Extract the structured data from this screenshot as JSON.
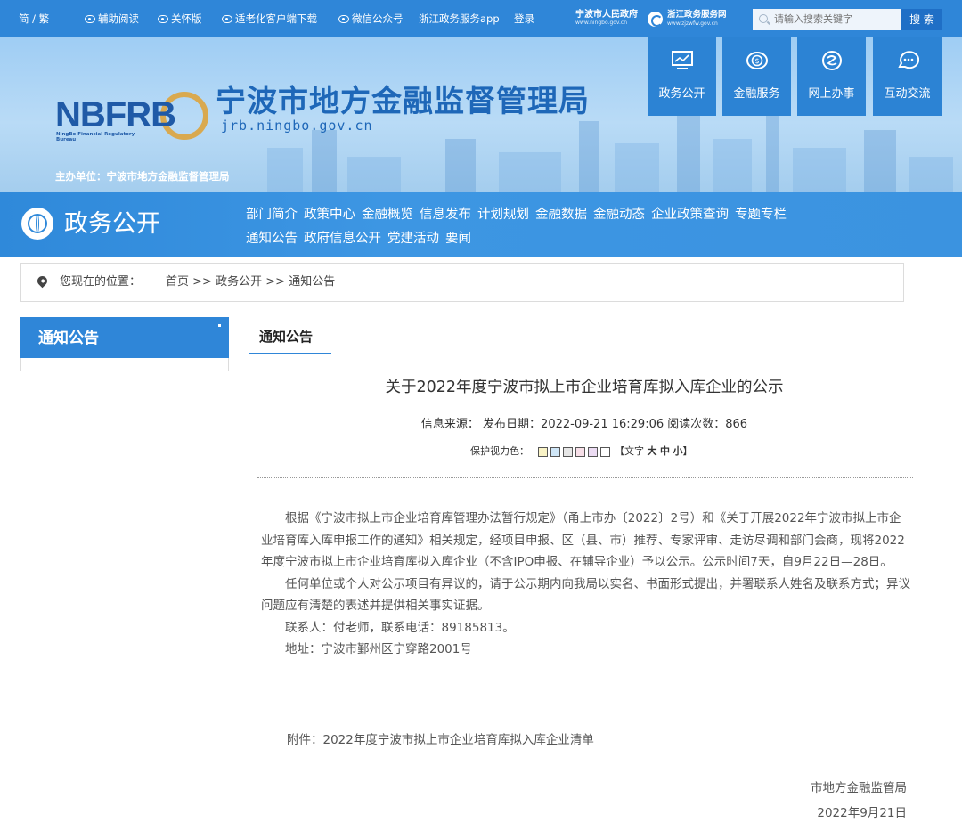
{
  "topbar": {
    "links": [
      "简 / 繁",
      "辅助阅读",
      "关怀版",
      "适老化客户端下载",
      "微信公众号",
      "浙江政务服务app",
      "登录"
    ],
    "gov_logo": {
      "name": "宁波市人民政府",
      "url_text": "www.ningbo.gov.cn"
    },
    "zj_logo": {
      "name": "浙江政务服务网",
      "url_text": "www.zjzwfw.gov.cn"
    },
    "search": {
      "placeholder": "请输入搜索关键字",
      "button": "搜 索"
    }
  },
  "banner": {
    "logo_text": "NBFRB",
    "logo_subtext": "NingBo Financial Regulatory Bureau",
    "title": "宁波市地方金融监督管理局",
    "domain": "jrb.ningbo.gov.cn",
    "sponsor": "主办单位：宁波市地方金融监督管理局",
    "quick_links": [
      {
        "label": "政务公开",
        "icon": "monitor-icon"
      },
      {
        "label": "金融服务",
        "icon": "coin-icon"
      },
      {
        "label": "网上办事",
        "icon": "service-icon"
      },
      {
        "label": "互动交流",
        "icon": "chat-icon"
      }
    ]
  },
  "nav": {
    "section_title": "政务公开",
    "links": [
      "部门简介",
      "政策中心",
      "金融概览",
      "信息发布",
      "计划规划",
      "金融数据",
      "金融动态",
      "企业政策查询",
      "专题专栏",
      "通知公告",
      "政府信息公开",
      "党建活动",
      "要闻"
    ]
  },
  "breadcrumb": {
    "prefix": "您现在的位置：",
    "items": [
      "首页",
      ">>",
      "政务公开",
      ">>",
      "通知公告"
    ]
  },
  "sidebar": {
    "title": "通知公告"
  },
  "content": {
    "tab": "通知公告",
    "article_title": "关于2022年度宁波市拟上市企业培育库拟入库企业的公示",
    "meta": "信息来源：  发布日期：2022-09-21 16:29:06 阅读次数：866",
    "protect_label": "保护视力色：",
    "protect_colors": [
      "#f9f3c6",
      "#cfe6f7",
      "#e6e6e6",
      "#f7dfe8",
      "#ecdcf3",
      "#ffffff"
    ],
    "textsize": {
      "open": "【文字 ",
      "large": "大",
      "medium": "中",
      "small": "小",
      "close": "】"
    },
    "paragraphs": [
      "根据《宁波市拟上市企业培育库管理办法暂行规定》（甬上市办〔2022〕2号）和《关于开展2022年宁波市拟上市企业培育库入库申报工作的通知》相关规定，经项目申报、区（县、市）推荐、专家评审、走访尽调和部门会商，现将2022年度宁波市拟上市企业培育库拟入库企业（不含IPO申报、在辅导企业）予以公示。公示时间7天，自9月22日—28日。",
      "任何单位或个人对公示项目有异议的，请于公示期内向我局以实名、书面形式提出，并署联系人姓名及联系方式；异议问题应有清楚的表述并提供相关事实证据。",
      "联系人：付老师，联系电话：89185813。",
      "地址：宁波市鄞州区宁穿路2001号"
    ],
    "attachment": "附件：2022年度宁波市拟上市企业培育库拟入库企业清单",
    "sign_org": "市地方金融监管局",
    "sign_date": "2022年9月21日"
  }
}
